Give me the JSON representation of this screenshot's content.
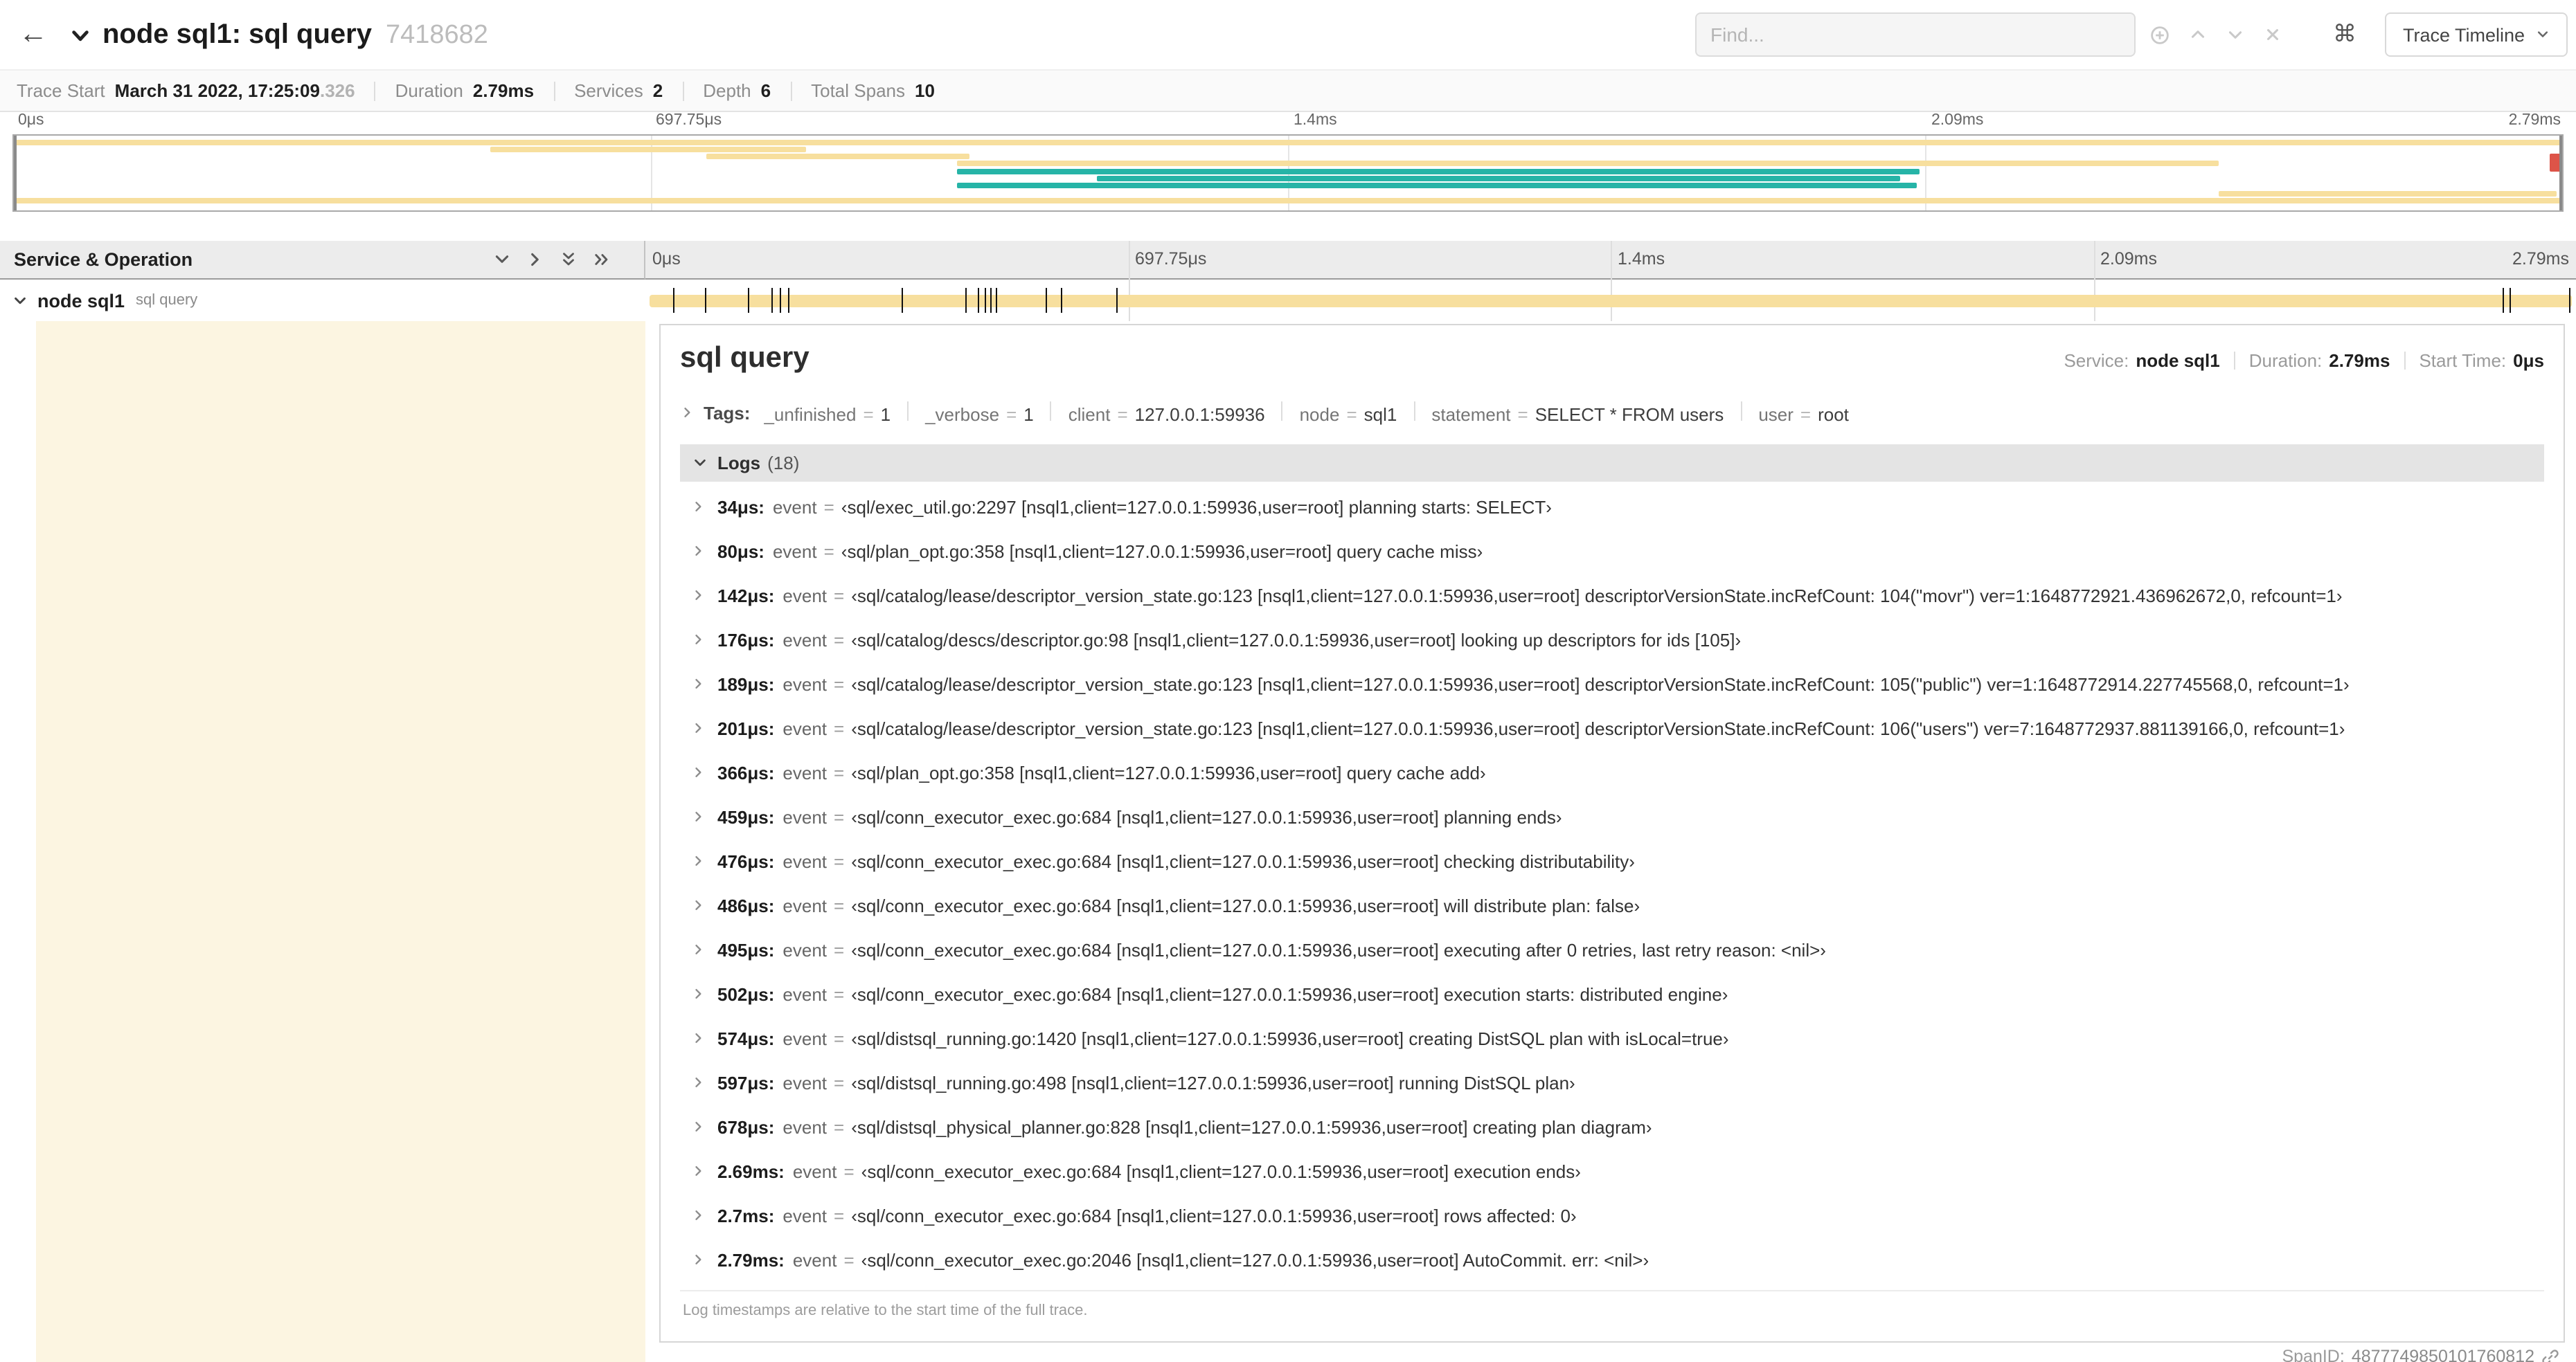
{
  "header": {
    "title": "node sql1: sql query",
    "trace_id": "7418682",
    "find_placeholder": "Find...",
    "shortcut_icon": "⌘",
    "trace_timeline_label": "Trace Timeline"
  },
  "summary": {
    "items": [
      {
        "label": "Trace Start",
        "value": "March 31 2022, 17:25:09",
        "muted": ".326"
      },
      {
        "label": "Duration",
        "value": "2.79ms"
      },
      {
        "label": "Services",
        "value": "2"
      },
      {
        "label": "Depth",
        "value": "6"
      },
      {
        "label": "Total Spans",
        "value": "10"
      }
    ]
  },
  "colors": {
    "span_tan": "#f7df9e",
    "span_teal": "#26b4a7",
    "span_red": "#dd5448"
  },
  "minimap": {
    "tick_labels": [
      "0μs",
      "697.75μs",
      "1.4ms",
      "2.09ms",
      "2.79ms"
    ],
    "bars": [
      {
        "row": 0,
        "left": 0,
        "width": 100,
        "color": "tan"
      },
      {
        "row": 1,
        "left": 18.7,
        "width": 12.4,
        "color": "tan"
      },
      {
        "row": 2,
        "left": 27.2,
        "width": 10.3,
        "color": "tan"
      },
      {
        "row": 3,
        "left": 37.0,
        "width": 49.5,
        "color": "tan"
      },
      {
        "row": 4,
        "left": 37.0,
        "width": 37.8,
        "color": "teal"
      },
      {
        "row": 5,
        "left": 42.5,
        "width": 31.5,
        "color": "teal"
      },
      {
        "row": 6,
        "left": 37.0,
        "width": 37.7,
        "color": "teal"
      },
      {
        "row": 7,
        "left": 86.5,
        "width": 13.3,
        "color": "tan"
      },
      {
        "row": 8,
        "left": 0,
        "width": 100,
        "color": "tan"
      },
      {
        "row": 2,
        "left": 99.5,
        "width": 0.5,
        "color": "red",
        "tall": true
      }
    ]
  },
  "timeline": {
    "left_header": "Service & Operation",
    "ruler_ticks": [
      "0μs",
      "697.75μs",
      "1.4ms",
      "2.09ms",
      "2.79ms"
    ],
    "total_us": 2790,
    "row": {
      "service": "node sql1",
      "operation": "sql query",
      "log_marks_us": [
        34,
        80,
        142,
        176,
        189,
        201,
        366,
        459,
        476,
        486,
        495,
        502,
        574,
        597,
        678,
        2690,
        2700,
        2790
      ]
    }
  },
  "detail": {
    "title": "sql query",
    "meta": [
      {
        "label": "Service:",
        "value": "node sql1"
      },
      {
        "label": "Duration:",
        "value": "2.79ms"
      },
      {
        "label": "Start Time:",
        "value": "0μs"
      }
    ],
    "tags_label": "Tags:",
    "tags": [
      {
        "key": "_unfinished",
        "value": "1"
      },
      {
        "key": "_verbose",
        "value": "1"
      },
      {
        "key": "client",
        "value": "127.0.0.1:59936"
      },
      {
        "key": "node",
        "value": "sql1"
      },
      {
        "key": "statement",
        "value": "SELECT * FROM users"
      },
      {
        "key": "user",
        "value": "root"
      }
    ],
    "logs_label": "Logs",
    "logs_count": "(18)",
    "logs": [
      {
        "time": "34μs:",
        "key": "event",
        "value": "‹sql/exec_util.go:2297 [nsql1,client=127.0.0.1:59936,user=root] planning starts: SELECT›"
      },
      {
        "time": "80μs:",
        "key": "event",
        "value": "‹sql/plan_opt.go:358 [nsql1,client=127.0.0.1:59936,user=root] query cache miss›"
      },
      {
        "time": "142μs:",
        "key": "event",
        "value": "‹sql/catalog/lease/descriptor_version_state.go:123 [nsql1,client=127.0.0.1:59936,user=root] descriptorVersionState.incRefCount: 104(\"movr\") ver=1:1648772921.436962672,0, refcount=1›"
      },
      {
        "time": "176μs:",
        "key": "event",
        "value": "‹sql/catalog/descs/descriptor.go:98 [nsql1,client=127.0.0.1:59936,user=root] looking up descriptors for ids [105]›"
      },
      {
        "time": "189μs:",
        "key": "event",
        "value": "‹sql/catalog/lease/descriptor_version_state.go:123 [nsql1,client=127.0.0.1:59936,user=root] descriptorVersionState.incRefCount: 105(\"public\") ver=1:1648772914.227745568,0, refcount=1›"
      },
      {
        "time": "201μs:",
        "key": "event",
        "value": "‹sql/catalog/lease/descriptor_version_state.go:123 [nsql1,client=127.0.0.1:59936,user=root] descriptorVersionState.incRefCount: 106(\"users\") ver=7:1648772937.881139166,0, refcount=1›"
      },
      {
        "time": "366μs:",
        "key": "event",
        "value": "‹sql/plan_opt.go:358 [nsql1,client=127.0.0.1:59936,user=root] query cache add›"
      },
      {
        "time": "459μs:",
        "key": "event",
        "value": "‹sql/conn_executor_exec.go:684 [nsql1,client=127.0.0.1:59936,user=root] planning ends›"
      },
      {
        "time": "476μs:",
        "key": "event",
        "value": "‹sql/conn_executor_exec.go:684 [nsql1,client=127.0.0.1:59936,user=root] checking distributability›"
      },
      {
        "time": "486μs:",
        "key": "event",
        "value": "‹sql/conn_executor_exec.go:684 [nsql1,client=127.0.0.1:59936,user=root] will distribute plan: false›"
      },
      {
        "time": "495μs:",
        "key": "event",
        "value": "‹sql/conn_executor_exec.go:684 [nsql1,client=127.0.0.1:59936,user=root] executing after 0 retries, last retry reason: <nil>›"
      },
      {
        "time": "502μs:",
        "key": "event",
        "value": "‹sql/conn_executor_exec.go:684 [nsql1,client=127.0.0.1:59936,user=root] execution starts: distributed engine›"
      },
      {
        "time": "574μs:",
        "key": "event",
        "value": "‹sql/distsql_running.go:1420 [nsql1,client=127.0.0.1:59936,user=root] creating DistSQL plan with isLocal=true›"
      },
      {
        "time": "597μs:",
        "key": "event",
        "value": "‹sql/distsql_running.go:498 [nsql1,client=127.0.0.1:59936,user=root] running DistSQL plan›"
      },
      {
        "time": "678μs:",
        "key": "event",
        "value": "‹sql/distsql_physical_planner.go:828 [nsql1,client=127.0.0.1:59936,user=root] creating plan diagram›"
      },
      {
        "time": "2.69ms:",
        "key": "event",
        "value": "‹sql/conn_executor_exec.go:684 [nsql1,client=127.0.0.1:59936,user=root] execution ends›"
      },
      {
        "time": "2.7ms:",
        "key": "event",
        "value": "‹sql/conn_executor_exec.go:684 [nsql1,client=127.0.0.1:59936,user=root] rows affected: 0›"
      },
      {
        "time": "2.79ms:",
        "key": "event",
        "value": "‹sql/conn_executor_exec.go:2046 [nsql1,client=127.0.0.1:59936,user=root] AutoCommit. err: <nil>›"
      }
    ],
    "footer_note": "Log timestamps are relative to the start time of the full trace.",
    "span_id_label": "SpanID:",
    "span_id": "4877749850101760812"
  }
}
